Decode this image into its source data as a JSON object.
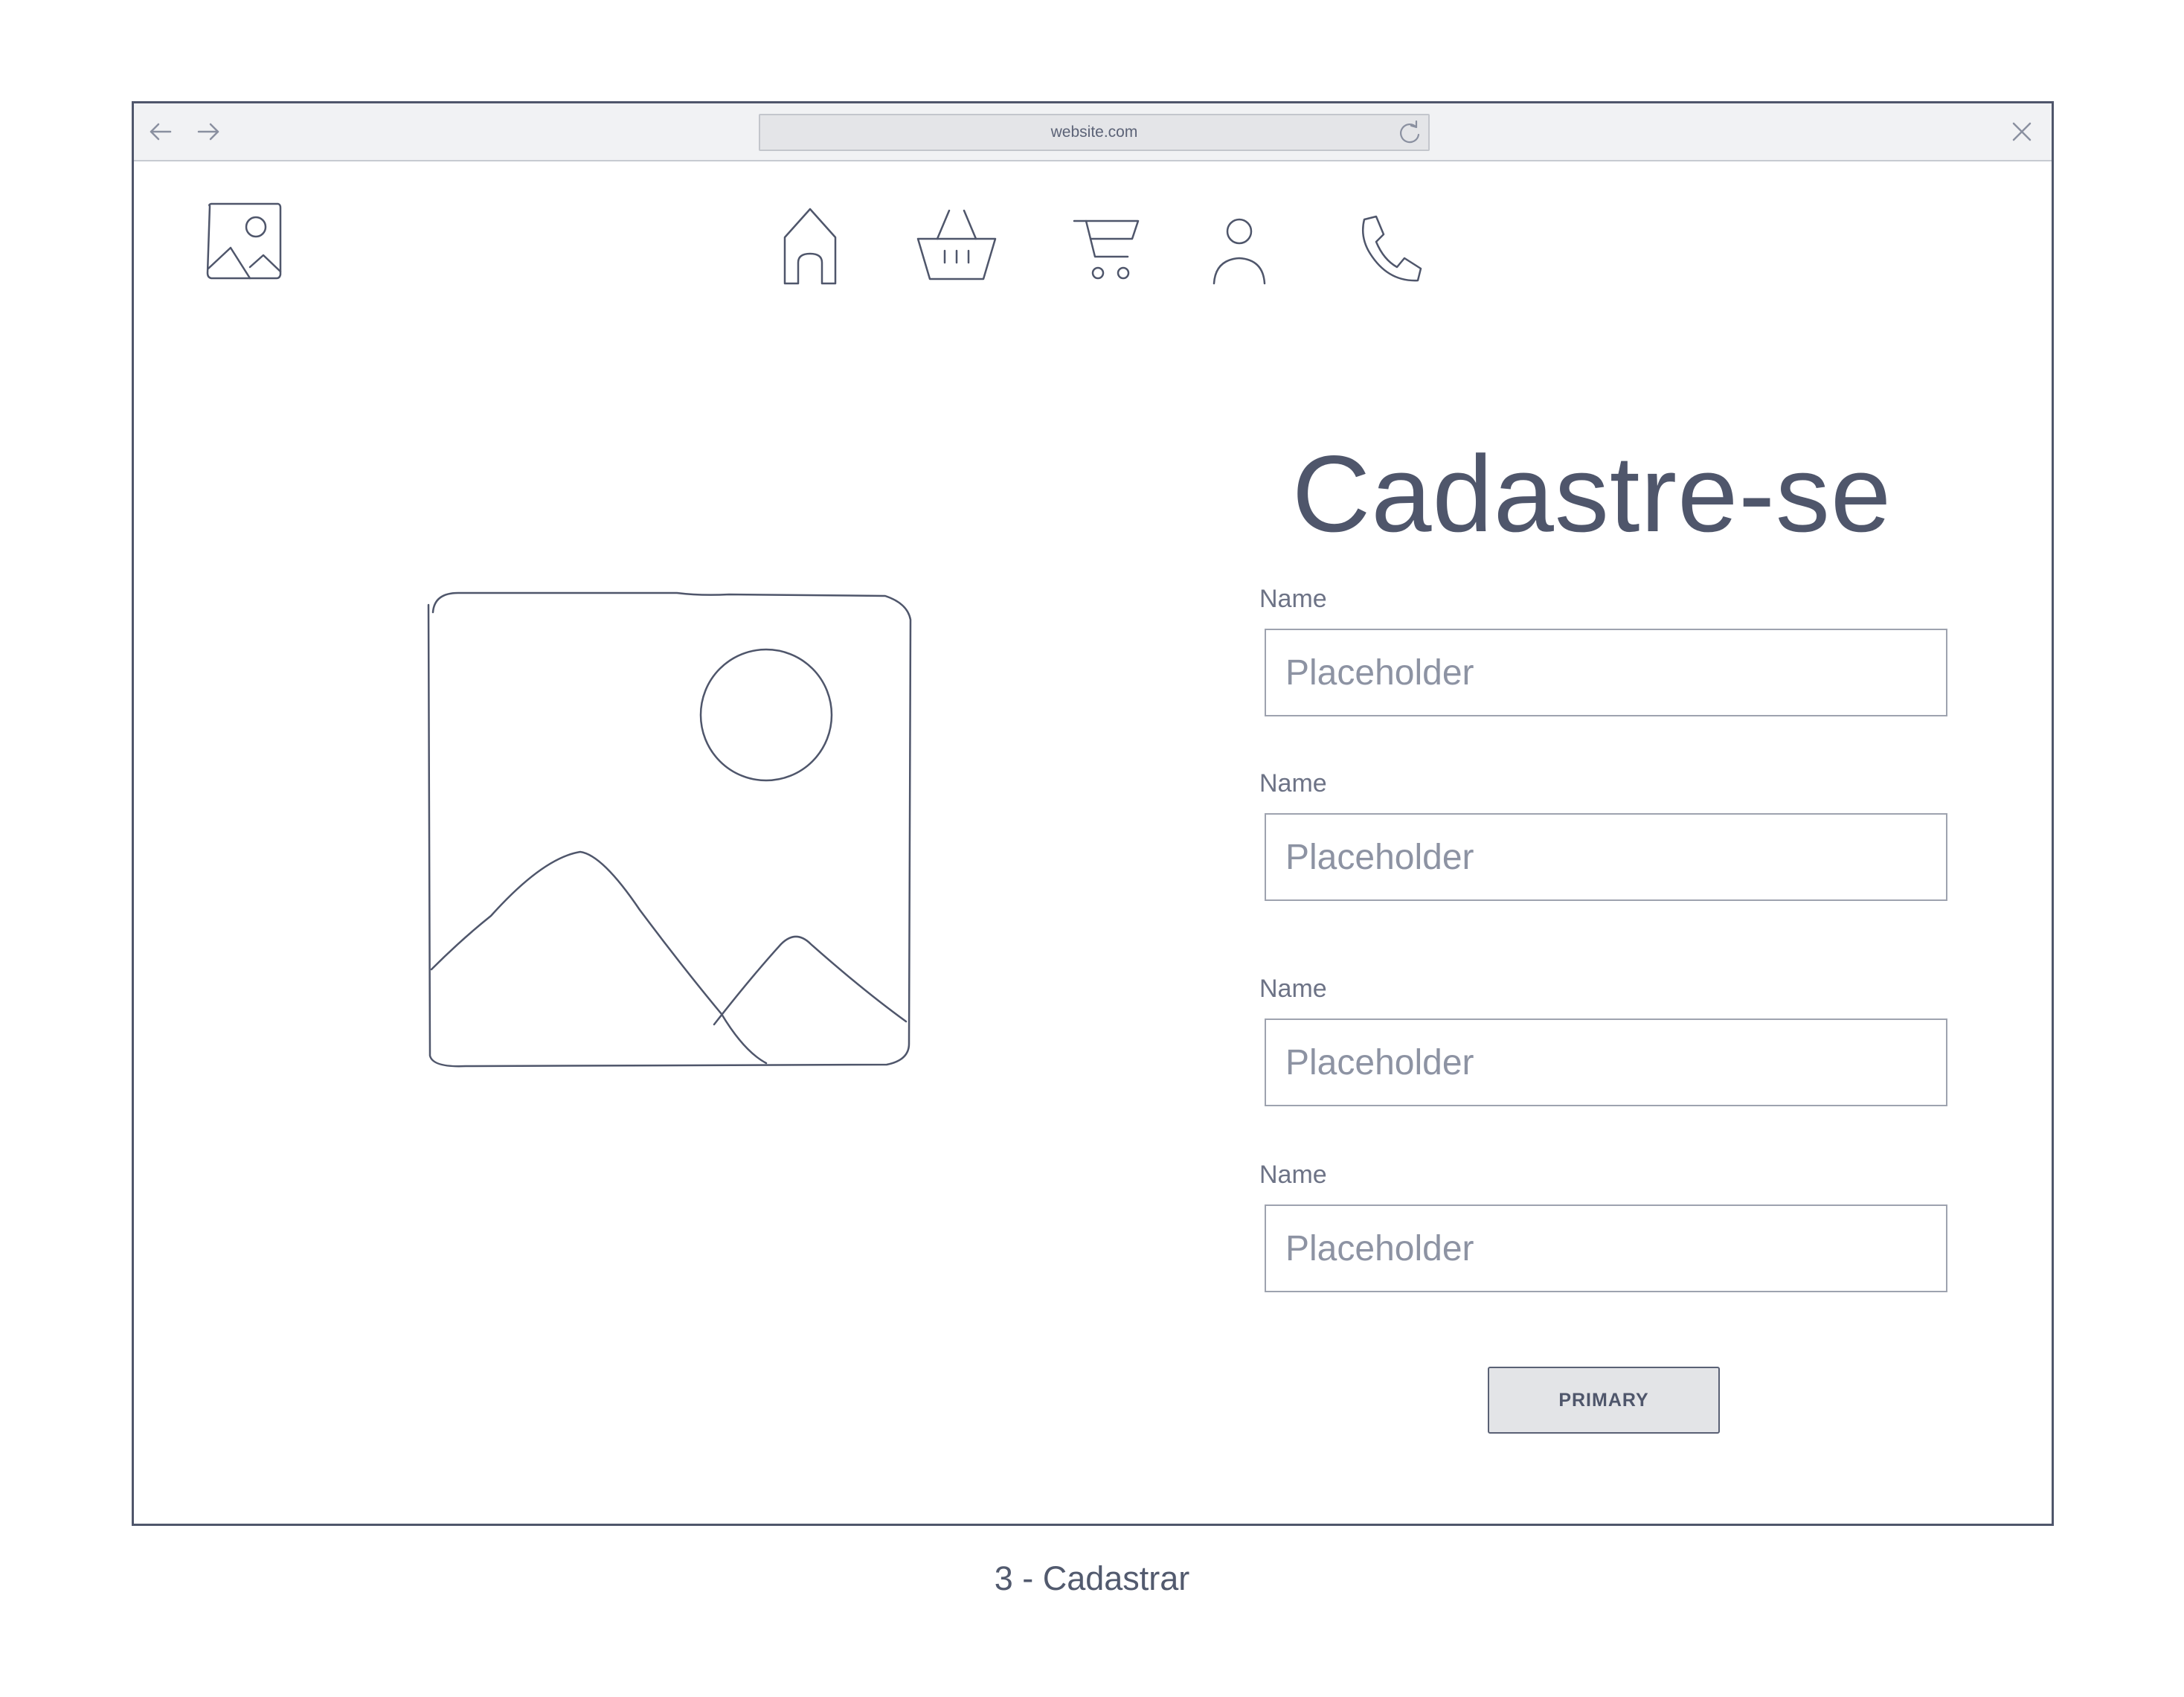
{
  "browser": {
    "url": "website.com",
    "icons": {
      "back": "arrow-left-icon",
      "forward": "arrow-right-icon",
      "reload": "reload-icon",
      "close": "close-icon"
    }
  },
  "header": {
    "logo_icon": "image-placeholder-icon",
    "nav": [
      {
        "icon": "home-icon"
      },
      {
        "icon": "basket-icon"
      },
      {
        "icon": "cart-icon"
      },
      {
        "icon": "user-icon"
      },
      {
        "icon": "phone-icon"
      }
    ]
  },
  "main": {
    "image_icon": "image-placeholder-icon",
    "title": "Cadastre-se",
    "fields": [
      {
        "label": "Name",
        "placeholder": "Placeholder",
        "value": ""
      },
      {
        "label": "Name",
        "placeholder": "Placeholder",
        "value": ""
      },
      {
        "label": "Name",
        "placeholder": "Placeholder",
        "value": ""
      },
      {
        "label": "Name",
        "placeholder": "Placeholder",
        "value": ""
      }
    ],
    "primary_button": "PRIMARY"
  },
  "caption": "3 - Cadastrar",
  "colors": {
    "stroke": "#4f566b",
    "toolbar_bg": "#f1f2f4",
    "button_bg": "#e3e4e7",
    "placeholder": "#8d93a3"
  }
}
